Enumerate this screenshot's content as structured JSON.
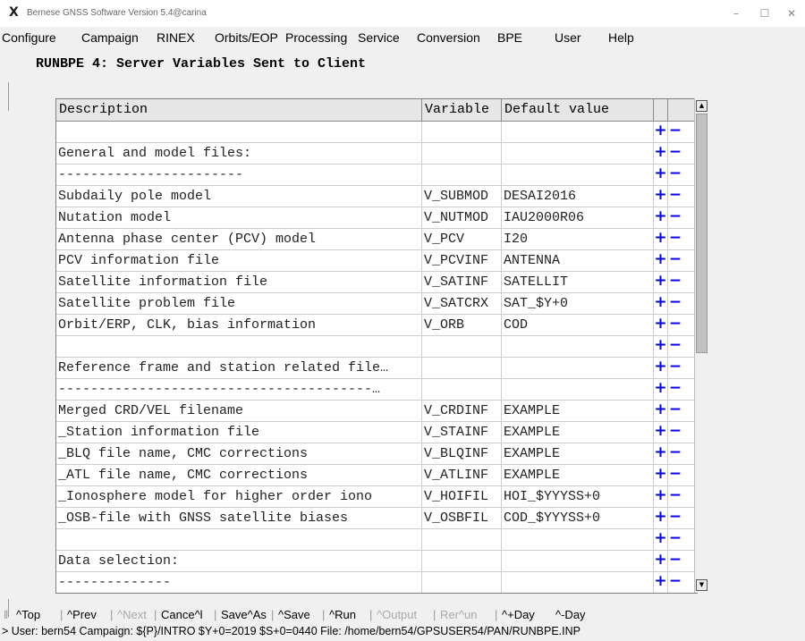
{
  "window": {
    "title": "Bernese GNSS Software Version 5.4@carina",
    "minimize": "–",
    "maximize": "☐",
    "close": "✕"
  },
  "menu": [
    "Configure",
    "Campaign",
    "RINEX",
    "Orbits/EOP",
    "Processing",
    "Service",
    "Conversion",
    "BPE",
    "User",
    "Help"
  ],
  "panel": {
    "title": "RUNBPE 4: Server Variables Sent to Client"
  },
  "table": {
    "headers": {
      "description": "Description",
      "variable": "Variable",
      "default": "Default value"
    },
    "plus": "+",
    "minus": "−",
    "rows": [
      {
        "desc": "",
        "var": "",
        "def": ""
      },
      {
        "desc": "General and model files:",
        "var": "",
        "def": ""
      },
      {
        "desc": "-----------------------",
        "var": "",
        "def": ""
      },
      {
        "desc": "Subdaily pole model",
        "var": "V_SUBMOD",
        "def": "DESAI2016"
      },
      {
        "desc": "Nutation model",
        "var": "V_NUTMOD",
        "def": "IAU2000R06"
      },
      {
        "desc": "Antenna phase center (PCV) model",
        "var": "V_PCV",
        "def": "I20"
      },
      {
        "desc": "PCV information file",
        "var": "V_PCVINF",
        "def": "ANTENNA"
      },
      {
        "desc": "Satellite information file",
        "var": "V_SATINF",
        "def": "SATELLIT"
      },
      {
        "desc": "Satellite problem file",
        "var": "V_SATCRX",
        "def": "SAT_$Y+0"
      },
      {
        "desc": "Orbit/ERP, CLK, bias information",
        "var": "V_ORB",
        "def": "COD"
      },
      {
        "desc": "",
        "var": "",
        "def": ""
      },
      {
        "desc": "Reference frame and station related file…",
        "var": "",
        "def": ""
      },
      {
        "desc": "---------------------------------------…",
        "var": "",
        "def": ""
      },
      {
        "desc": "Merged CRD/VEL filename",
        "var": "V_CRDINF",
        "def": "EXAMPLE"
      },
      {
        "desc": "_Station information file",
        "var": "V_STAINF",
        "def": "EXAMPLE"
      },
      {
        "desc": "_BLQ file name, CMC corrections",
        "var": "V_BLQINF",
        "def": "EXAMPLE"
      },
      {
        "desc": "_ATL file name, CMC corrections",
        "var": "V_ATLINF",
        "def": "EXAMPLE"
      },
      {
        "desc": "_Ionosphere model for higher order iono",
        "var": "V_HOIFIL",
        "def": "HOI_$YYYSS+0"
      },
      {
        "desc": "_OSB-file with GNSS satellite biases",
        "var": "V_OSBFIL",
        "def": "COD_$YYYSS+0"
      },
      {
        "desc": "",
        "var": "",
        "def": ""
      },
      {
        "desc": "Data selection:",
        "var": "",
        "def": ""
      },
      {
        "desc": "--------------",
        "var": "",
        "def": ""
      },
      {
        "desc": "",
        "var": "",
        "def": ""
      }
    ]
  },
  "scrollbar": {
    "up": "▲",
    "down": "▼"
  },
  "buttons": [
    {
      "label": "^Top",
      "enabled": true
    },
    {
      "label": "^Prev",
      "enabled": true
    },
    {
      "label": "^Next",
      "enabled": false
    },
    {
      "label": "Cance^l",
      "enabled": true
    },
    {
      "label": "Save^As",
      "enabled": true
    },
    {
      "label": "^Save",
      "enabled": true
    },
    {
      "label": "^Run",
      "enabled": true
    },
    {
      "label": "^Output",
      "enabled": false
    },
    {
      "label": "Rer^un",
      "enabled": false
    },
    {
      "label": "^+Day",
      "enabled": true
    },
    {
      "label": "^-Day",
      "enabled": true
    }
  ],
  "status": "> User: bern54  Campaign: ${P}/INTRO  $Y+0=2019  $S+0=0440  File: /home/bern54/GPSUSER54/PAN/RUNBPE.INP"
}
